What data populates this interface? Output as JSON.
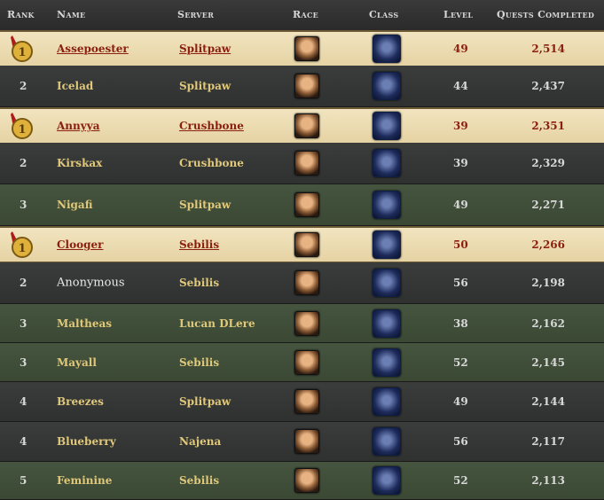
{
  "header": {
    "rank": "Rank",
    "name": "Name",
    "server": "Server",
    "race": "Race",
    "class": "Class",
    "level": "Level",
    "quests": "Quests Completed"
  },
  "rows": [
    {
      "rank": "",
      "name": "Assepoester",
      "server": "Splitpaw",
      "level": "49",
      "quests": "2,514",
      "style": "gold"
    },
    {
      "rank": "2",
      "name": "Icelad",
      "server": "Splitpaw",
      "level": "44",
      "quests": "2,437",
      "style": "gray"
    },
    {
      "rank": "",
      "name": "Annyya",
      "server": "Crushbone",
      "level": "39",
      "quests": "2,351",
      "style": "gold"
    },
    {
      "rank": "2",
      "name": "Kirskax",
      "server": "Crushbone",
      "level": "39",
      "quests": "2,329",
      "style": "gray"
    },
    {
      "rank": "3",
      "name": "Nigafi",
      "server": "Splitpaw",
      "level": "49",
      "quests": "2,271",
      "style": "green"
    },
    {
      "rank": "",
      "name": "Clooger",
      "server": "Sebilis",
      "level": "50",
      "quests": "2,266",
      "style": "gold"
    },
    {
      "rank": "2",
      "name": "Anonymous",
      "server": "Sebilis",
      "level": "56",
      "quests": "2,198",
      "style": "gray"
    },
    {
      "rank": "3",
      "name": "Maltheas",
      "server": "Lucan DLere",
      "level": "38",
      "quests": "2,162",
      "style": "green"
    },
    {
      "rank": "3",
      "name": "Mayall",
      "server": "Sebilis",
      "level": "52",
      "quests": "2,145",
      "style": "green"
    },
    {
      "rank": "4",
      "name": "Breezes",
      "server": "Splitpaw",
      "level": "49",
      "quests": "2,144",
      "style": "gray"
    },
    {
      "rank": "4",
      "name": "Blueberry",
      "server": "Najena",
      "level": "56",
      "quests": "2,117",
      "style": "gray"
    },
    {
      "rank": "5",
      "name": "Feminine",
      "server": "Sebilis",
      "level": "52",
      "quests": "2,113",
      "style": "green"
    }
  ],
  "medal_label": "1"
}
